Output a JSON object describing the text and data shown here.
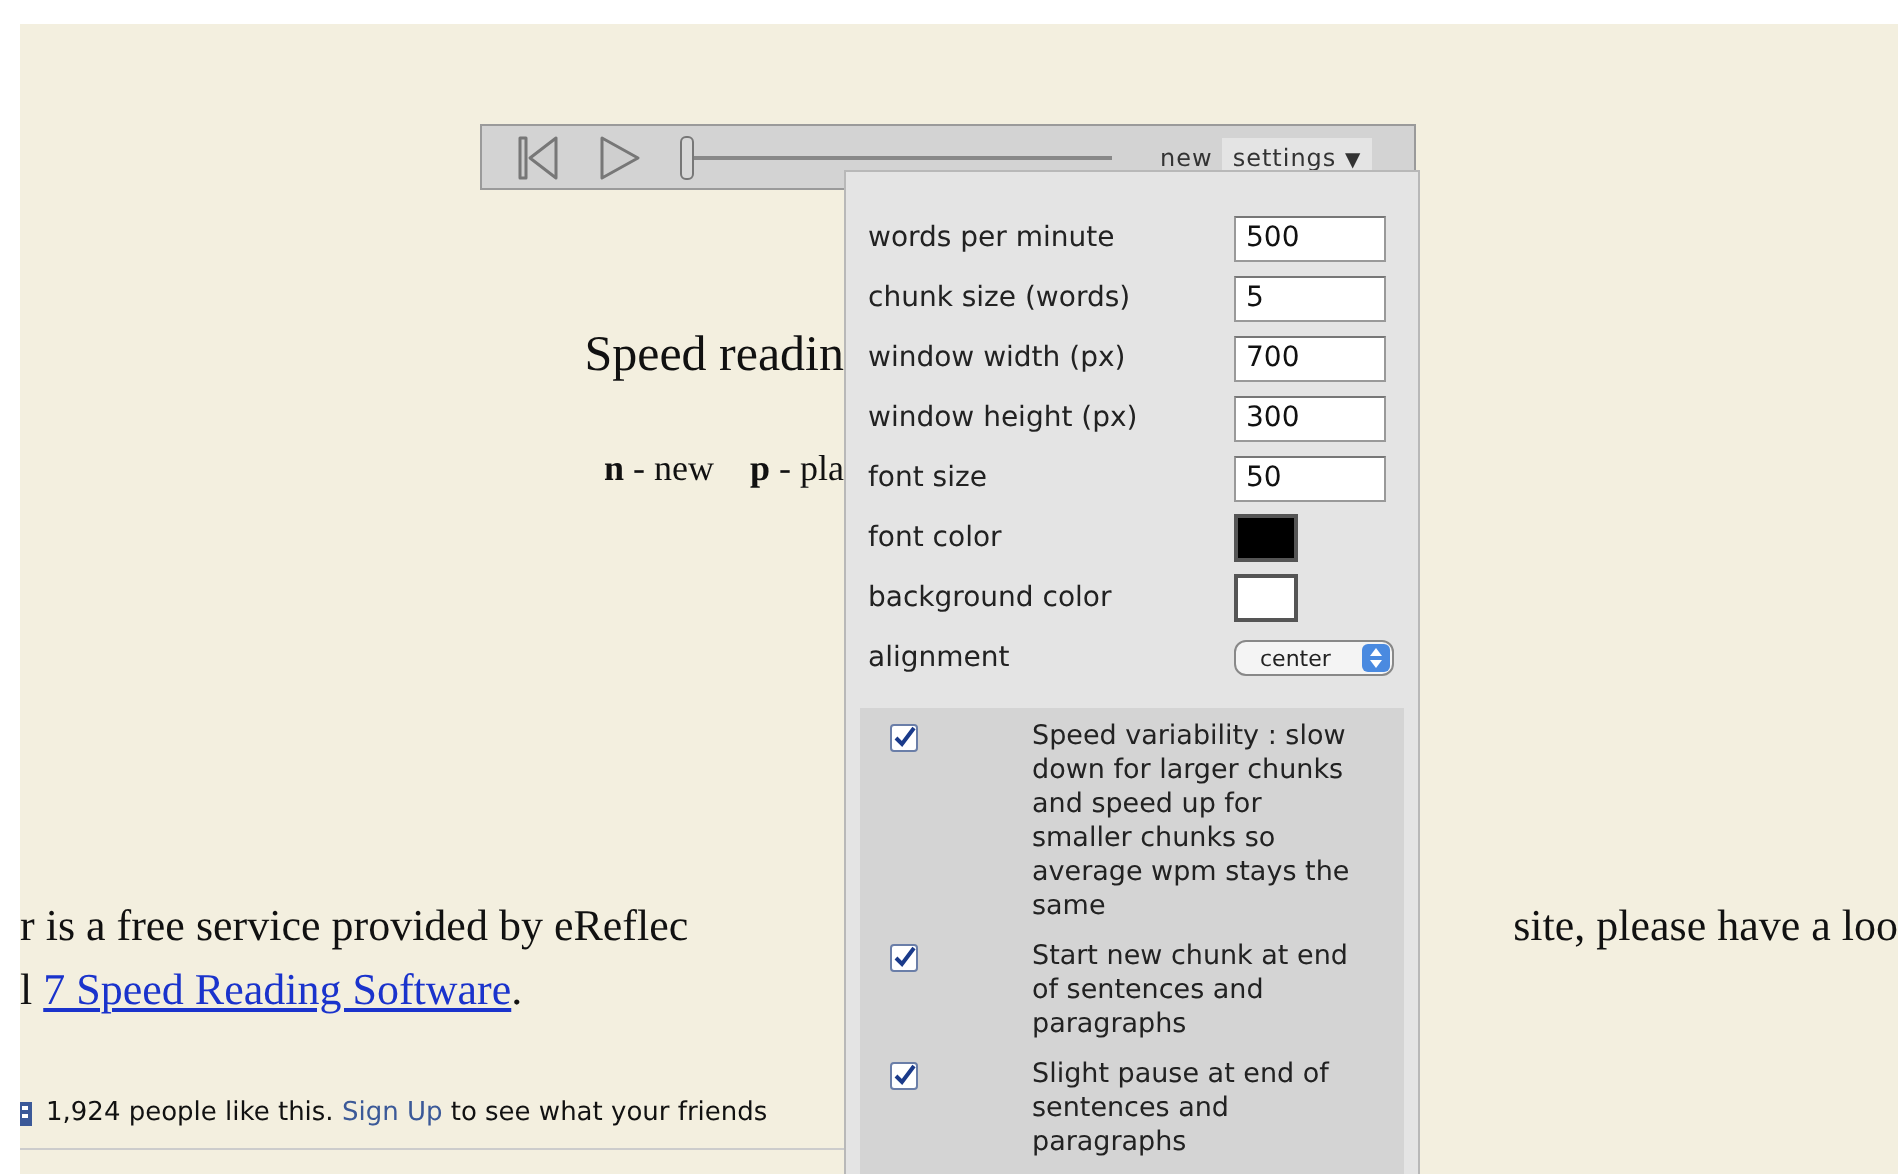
{
  "player": {
    "slider": {
      "level": 0
    },
    "new_label": "new",
    "settings_tab": {
      "label": "settings",
      "arrow": "▼",
      "expanded": true
    }
  },
  "page": {
    "heading": "Speed readin",
    "shortcuts": [
      {
        "key": "n",
        "action": "- new"
      },
      {
        "key": "p",
        "action": "- pla"
      }
    ],
    "intro_left": "r is a free service provided by eReflec",
    "intro_right": "site, please have a loo",
    "line2_prefix": "l",
    "line2_link": "7 Speed Reading Software",
    "line2_suffix": ".",
    "like_count": "1,924 people like this.",
    "like_link": "Sign Up",
    "like_rest": "to see what your friends"
  },
  "settings": {
    "fields": [
      {
        "label": "words per minute",
        "value": "500",
        "kind": "text"
      },
      {
        "label": "chunk size (words)",
        "value": "5",
        "kind": "text"
      },
      {
        "label": "window width (px)",
        "value": "700",
        "kind": "text"
      },
      {
        "label": "window height (px)",
        "value": "300",
        "kind": "text"
      },
      {
        "label": "font size",
        "value": "50",
        "kind": "text"
      },
      {
        "label": "font color",
        "color": "#000000",
        "kind": "color"
      },
      {
        "label": "background color",
        "color": "#ffffff",
        "kind": "color"
      },
      {
        "label": "alignment",
        "value": "center",
        "kind": "select"
      }
    ],
    "options": [
      {
        "label": "Speed variability : slow down for larger chunks and speed up for smaller chunks so average wpm stays the same",
        "checked": true
      },
      {
        "label": "Start new chunk at end of sentences and paragraphs",
        "checked": true
      },
      {
        "label": "Slight pause at end of sentences and paragraphs",
        "checked": true
      }
    ]
  }
}
